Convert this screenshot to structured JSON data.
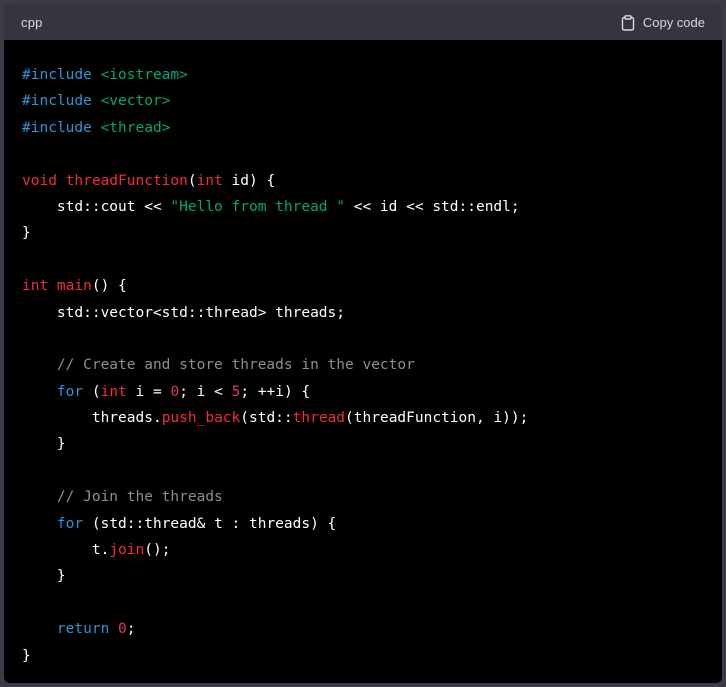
{
  "header": {
    "language": "cpp",
    "copy_label": "Copy code"
  },
  "icons": {
    "copy": "clipboard-icon"
  },
  "colors": {
    "page_background": "#3a3b44",
    "header_background": "#343541",
    "code_background": "#000000",
    "text": "#ffffff",
    "keyword": "#2e95d3",
    "string": "#00a67d",
    "function_and_type": "#f22c3d",
    "number": "#df3079",
    "comment": "#8e8e9a"
  },
  "code": {
    "lines": [
      [
        {
          "t": "#include ",
          "c": "kw"
        },
        {
          "t": "<iostream>",
          "c": "str"
        }
      ],
      [
        {
          "t": "#include ",
          "c": "kw"
        },
        {
          "t": "<vector>",
          "c": "str"
        }
      ],
      [
        {
          "t": "#include ",
          "c": "kw"
        },
        {
          "t": "<thread>",
          "c": "str"
        }
      ],
      [],
      [
        {
          "t": "void ",
          "c": "type"
        },
        {
          "t": "threadFunction",
          "c": "fn"
        },
        {
          "t": "(",
          "c": "tx"
        },
        {
          "t": "int",
          "c": "type"
        },
        {
          "t": " id) {",
          "c": "tx"
        }
      ],
      [
        {
          "t": "    std::cout << ",
          "c": "tx"
        },
        {
          "t": "\"Hello from thread \"",
          "c": "str"
        },
        {
          "t": " << id << std::endl;",
          "c": "tx"
        }
      ],
      [
        {
          "t": "}",
          "c": "tx"
        }
      ],
      [],
      [
        {
          "t": "int ",
          "c": "type"
        },
        {
          "t": "main",
          "c": "fn"
        },
        {
          "t": "() {",
          "c": "tx"
        }
      ],
      [
        {
          "t": "    std::vector<std::thread> threads;",
          "c": "tx"
        }
      ],
      [],
      [
        {
          "t": "    // Create and store threads in the vector",
          "c": "cmt"
        }
      ],
      [
        {
          "t": "    ",
          "c": "tx"
        },
        {
          "t": "for",
          "c": "kw"
        },
        {
          "t": " (",
          "c": "tx"
        },
        {
          "t": "int",
          "c": "type"
        },
        {
          "t": " i = ",
          "c": "tx"
        },
        {
          "t": "0",
          "c": "num"
        },
        {
          "t": "; i < ",
          "c": "tx"
        },
        {
          "t": "5",
          "c": "num"
        },
        {
          "t": "; ++i) {",
          "c": "tx"
        }
      ],
      [
        {
          "t": "        threads.",
          "c": "tx"
        },
        {
          "t": "push_back",
          "c": "fn"
        },
        {
          "t": "(std::",
          "c": "tx"
        },
        {
          "t": "thread",
          "c": "fn"
        },
        {
          "t": "(threadFunction, i));",
          "c": "tx"
        }
      ],
      [
        {
          "t": "    }",
          "c": "tx"
        }
      ],
      [],
      [
        {
          "t": "    // Join the threads",
          "c": "cmt"
        }
      ],
      [
        {
          "t": "    ",
          "c": "tx"
        },
        {
          "t": "for",
          "c": "kw"
        },
        {
          "t": " (std::thread& t : threads) {",
          "c": "tx"
        }
      ],
      [
        {
          "t": "        t.",
          "c": "tx"
        },
        {
          "t": "join",
          "c": "fn"
        },
        {
          "t": "();",
          "c": "tx"
        }
      ],
      [
        {
          "t": "    }",
          "c": "tx"
        }
      ],
      [],
      [
        {
          "t": "    ",
          "c": "tx"
        },
        {
          "t": "return",
          "c": "kw"
        },
        {
          "t": " ",
          "c": "tx"
        },
        {
          "t": "0",
          "c": "num"
        },
        {
          "t": ";",
          "c": "tx"
        }
      ],
      [
        {
          "t": "}",
          "c": "tx"
        }
      ]
    ]
  }
}
